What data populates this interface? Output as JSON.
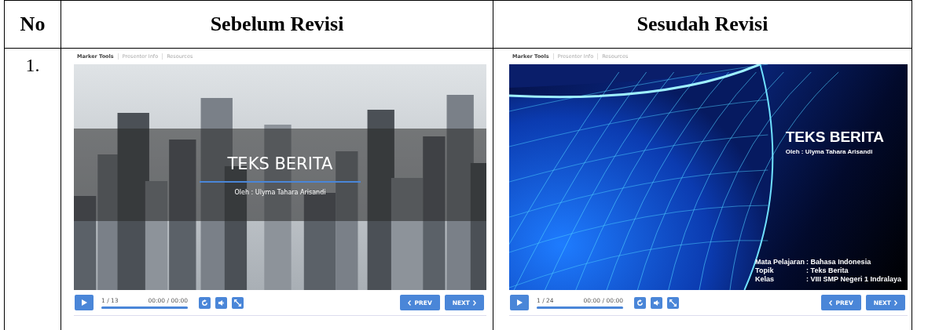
{
  "table": {
    "columns": [
      "No",
      "Sebelum Revisi",
      "Sesudah Revisi"
    ],
    "rows": [
      {
        "no": "1.",
        "players": [
          {
            "tabs": [
              {
                "label": "Marker Tools",
                "selected": true
              },
              {
                "label": "Presenter Info",
                "selected": false
              },
              {
                "label": "Resources",
                "selected": false
              }
            ],
            "slide": {
              "kind": "city",
              "title": "TEKS BERITA",
              "subtitle": "Oleh : Ulyma Tahara Arisandi"
            },
            "counter": "1 / 13",
            "time": "00:00 / 00:00",
            "level": 1,
            "prev": "PREV",
            "next": "NEXT"
          },
          {
            "tabs": [
              {
                "label": "Marker Tools",
                "selected": true
              },
              {
                "label": "Presenter Info",
                "selected": false
              },
              {
                "label": "Resources",
                "selected": false
              }
            ],
            "slide": {
              "kind": "globe",
              "title": "TEKS BERITA",
              "subtitle": "Oleh : Ulyma Tahara Arisandi",
              "details": [
                {
                  "label": "Mata Pelajaran",
                  "value": ": Bahasa Indonesia"
                },
                {
                  "label": "Topik",
                  "value": ": Teks Berita"
                },
                {
                  "label": "Kelas",
                  "value": ": VIII SMP Negeri 1 Indralaya"
                }
              ]
            },
            "counter": "1 / 24",
            "time": "00:00 / 00:00",
            "level": 1,
            "prev": "PREV",
            "next": "NEXT"
          }
        ]
      }
    ]
  }
}
